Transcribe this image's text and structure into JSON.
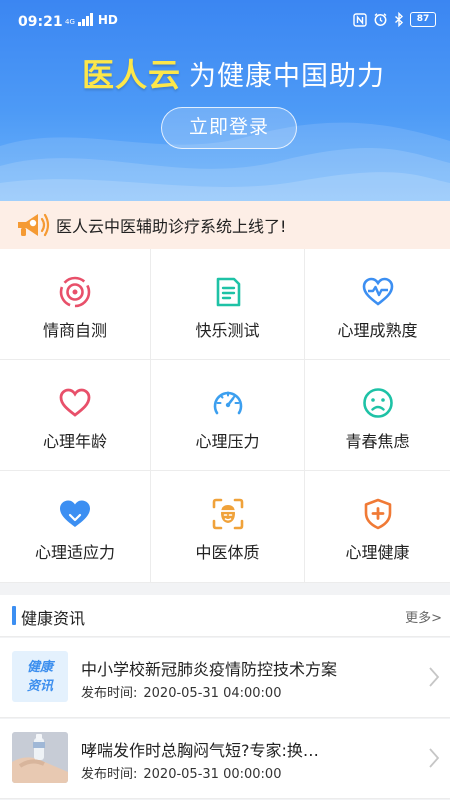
{
  "status_bar": {
    "time": "09:21",
    "network_small": "4G",
    "network_type": "HD",
    "battery": "87"
  },
  "header": {
    "logo_text": "医人云",
    "slogan": "为健康中国助力",
    "login_label": "立即登录"
  },
  "notice": {
    "text": "医人云中医辅助诊疗系统上线了!"
  },
  "grid": [
    {
      "label": "情商自测",
      "icon": "target-icon",
      "color": "#e8506a"
    },
    {
      "label": "快乐测试",
      "icon": "document-icon",
      "color": "#1ec2a6"
    },
    {
      "label": "心理成熟度",
      "icon": "heart-pulse-icon",
      "color": "#3c8ff2"
    },
    {
      "label": "心理年龄",
      "icon": "heart-outline-icon",
      "color": "#e8506a"
    },
    {
      "label": "心理压力",
      "icon": "gauge-icon",
      "color": "#3c9fef"
    },
    {
      "label": "青春焦虑",
      "icon": "sad-face-icon",
      "color": "#1ec2a6"
    },
    {
      "label": "心理适应力",
      "icon": "heart-filled-icon",
      "color": "#3c8ff2"
    },
    {
      "label": "中医体质",
      "icon": "face-scan-icon",
      "color": "#f0a23a"
    },
    {
      "label": "心理健康",
      "icon": "shield-plus-icon",
      "color": "#f07a36"
    }
  ],
  "news": {
    "title": "健康资讯",
    "more_label": "更多>",
    "items": [
      {
        "thumb_line1": "健康",
        "thumb_line2": "资讯",
        "headline": "中小学校新冠肺炎疫情防控技术方案",
        "time_label": "发布时间:",
        "time": "2020-05-31 04:00:00"
      },
      {
        "headline": "哮喘发作时总胸闷气短?专家:换…",
        "time_label": "发布时间:",
        "time": "2020-05-31 00:00:00"
      }
    ]
  }
}
